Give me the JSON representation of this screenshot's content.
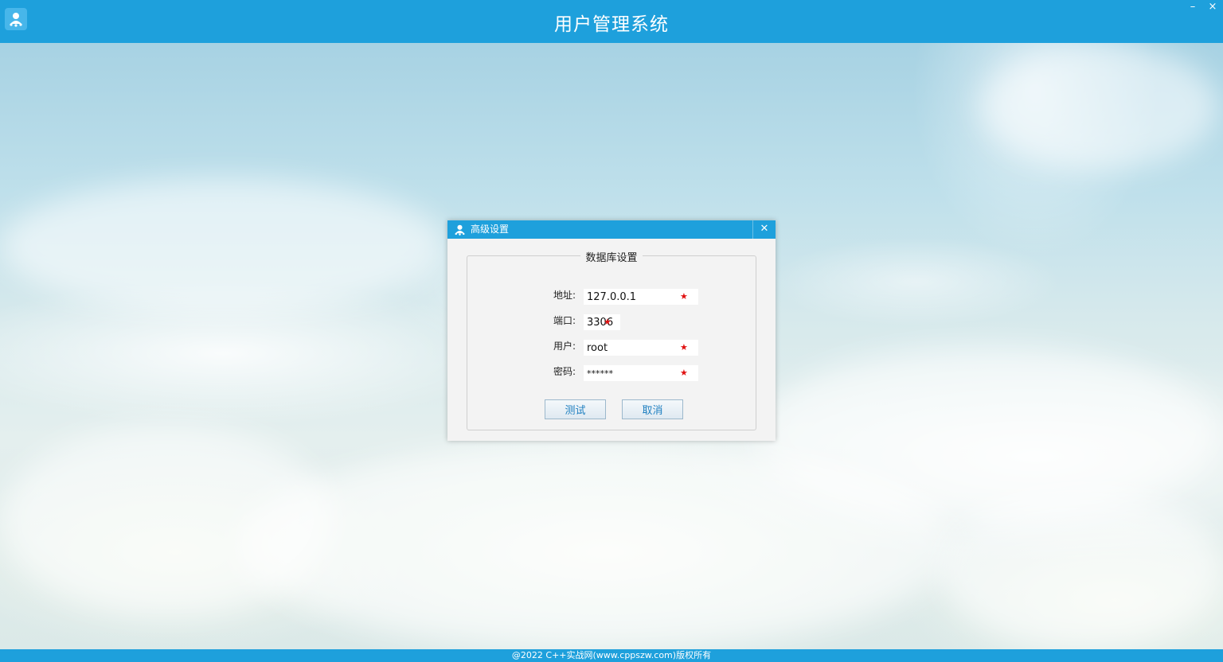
{
  "window": {
    "title": "用户管理系统",
    "minimize_glyph": "–",
    "close_glyph": "×",
    "icon": "user-network-icon"
  },
  "footer": {
    "text": "@2022 C++实战网(www.cppszw.com)版权所有"
  },
  "dialog": {
    "title": "高级设置",
    "icon": "user-network-icon",
    "close_glyph": "✕",
    "group_title": "数据库设置",
    "fields": {
      "address": {
        "label": "地址:",
        "value": "127.0.0.1",
        "required_mark": "★"
      },
      "port": {
        "label": "端口:",
        "value": "3306",
        "required_mark": "★"
      },
      "user": {
        "label": "用户:",
        "value": "root",
        "required_mark": "★"
      },
      "password": {
        "label": "密码:",
        "value": "******",
        "required_mark": "★"
      }
    },
    "buttons": {
      "test": "测试",
      "cancel": "取消"
    }
  },
  "colors": {
    "titlebar": "#1ea0dc",
    "dialog_bg": "#f3f3f3",
    "required": "#e01010",
    "button_text": "#1e7fc0"
  }
}
